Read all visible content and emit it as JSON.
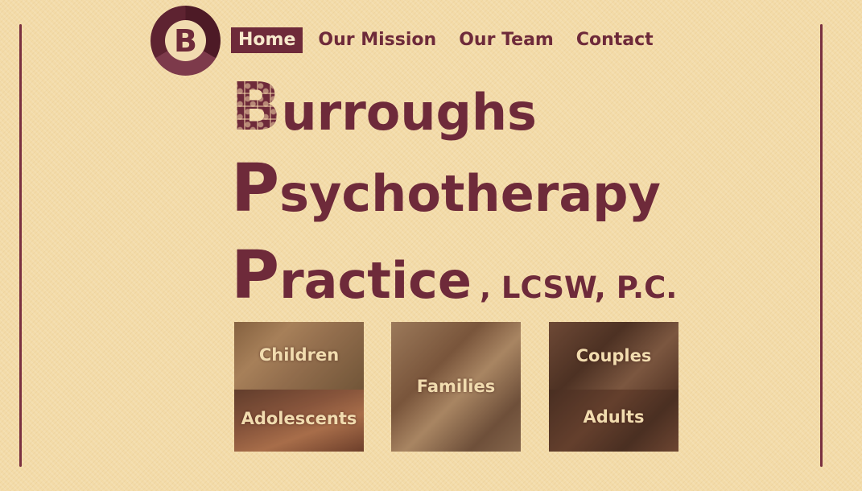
{
  "nav": {
    "items": [
      {
        "label": "Home",
        "active": true
      },
      {
        "label": "Our Mission",
        "active": false
      },
      {
        "label": "Our Team",
        "active": false
      },
      {
        "label": "Contact",
        "active": false
      }
    ]
  },
  "logo": {
    "letter": "B"
  },
  "title": {
    "line1": {
      "initial": "B",
      "rest": "urroughs"
    },
    "line2": {
      "initial": "P",
      "rest": "sychotherapy"
    },
    "line3": {
      "initial": "P",
      "rest": "ractice",
      "suffix": ", LCSW, P.C."
    }
  },
  "tiles": {
    "children": "Children",
    "adolescents": "Adolescents",
    "families": "Families",
    "couples": "Couples",
    "adults": "Adults"
  },
  "colors": {
    "background": "#f3dba8",
    "brand": "#6e2a3a",
    "tile_text": "#f1dcaf"
  }
}
